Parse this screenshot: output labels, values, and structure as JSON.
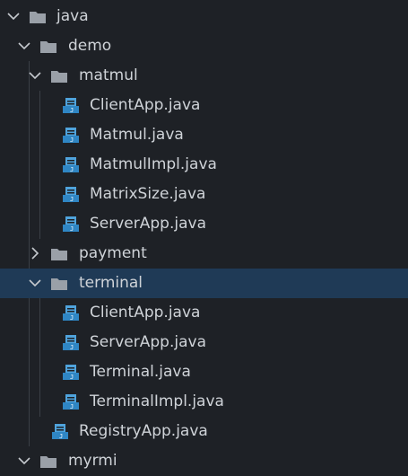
{
  "tree": {
    "java": "java",
    "demo": "demo",
    "matmul": "matmul",
    "matmul_files": [
      "ClientApp.java",
      "Matmul.java",
      "MatmulImpl.java",
      "MatrixSize.java",
      "ServerApp.java"
    ],
    "payment": "payment",
    "terminal": "terminal",
    "terminal_files": [
      "ClientApp.java",
      "ServerApp.java",
      "Terminal.java",
      "TerminalImpl.java"
    ],
    "registry_app": "RegistryApp.java",
    "myrmi": "myrmi"
  },
  "colors": {
    "background": "#1e2126",
    "selected_row": "#1f3a56",
    "folder_icon": "#9aa0a8",
    "java_file_icon": "#4fa3dc",
    "indent_guide": "#3a3f46"
  },
  "icons": {
    "folder": "folder-icon",
    "java_file": "java-file-icon",
    "expanded": "chevron-down-icon",
    "collapsed": "chevron-right-icon"
  }
}
